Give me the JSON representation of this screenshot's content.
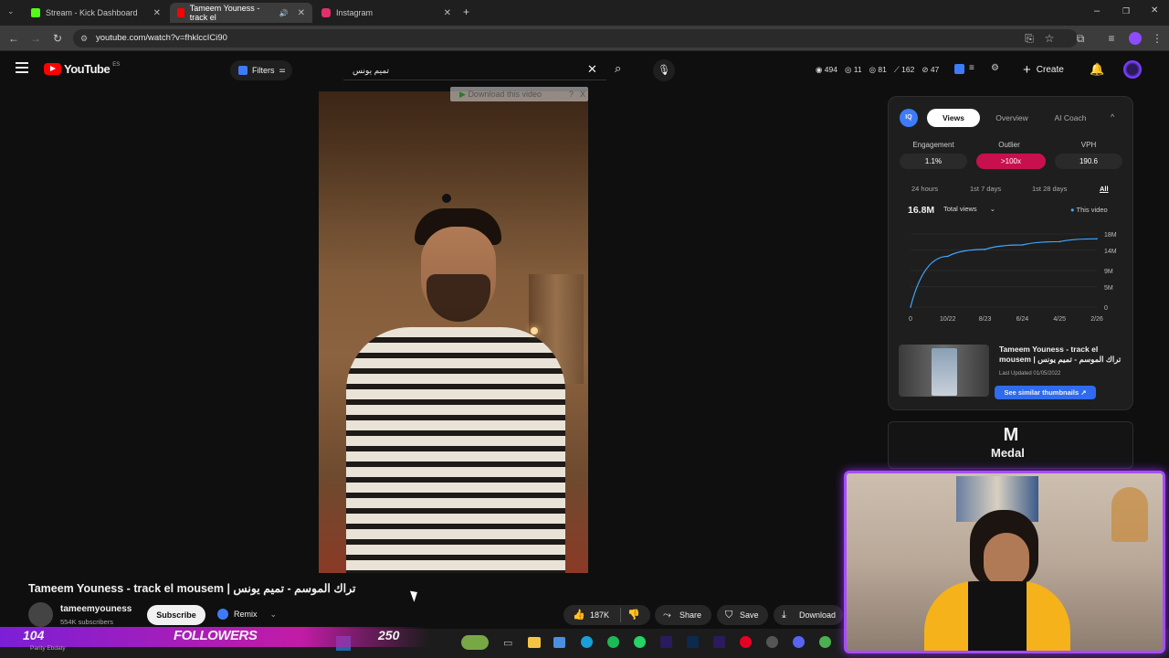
{
  "browser": {
    "tabs": [
      {
        "label": "Stream - Kick Dashboard",
        "color": "#53fc18"
      },
      {
        "label": "Tameem Youness - track el",
        "color": "#ff0000"
      },
      {
        "label": "Instagram",
        "color": "#e1306c"
      }
    ],
    "url": "youtube.com/watch?v=fhklccICi90"
  },
  "youtube": {
    "logo_text": "YouTube",
    "logo_sup": "ES",
    "filters_label": "Filters",
    "search_value": "تميم يونس",
    "stats": {
      "views": "494",
      "a": "11",
      "b": "81",
      "c": "162",
      "d": "47"
    },
    "create_label": "Create"
  },
  "download_bar": {
    "label": "Download this video",
    "q": "?",
    "x": "X"
  },
  "panel": {
    "tabs": [
      "Views",
      "Overview",
      "AI Coach"
    ],
    "metrics": [
      {
        "label": "Engagement",
        "value": "1.1%"
      },
      {
        "label": "Outlier",
        "value": ">100x"
      },
      {
        "label": "VPH",
        "value": "190.6"
      }
    ],
    "ranges": [
      "24 hours",
      "1st 7 days",
      "1st 28 days",
      "All"
    ],
    "total": "16.8M",
    "total_select": "Total views",
    "legend": "This video",
    "y_ticks": [
      "18M",
      "14M",
      "9M",
      "5M",
      "0"
    ],
    "x_ticks": [
      "0",
      "10/22",
      "8/23",
      "6/24",
      "4/25",
      "2/26"
    ],
    "video_title": "Tameem Youness - track el mousem | تراك الموسم - تميم يونس",
    "updated": "Last Updated 01/05/2022",
    "similar_btn": "See similar thumbnails"
  },
  "chart_data": {
    "type": "line",
    "x": [
      "0",
      "10/22",
      "8/23",
      "6/24",
      "4/25",
      "2/26"
    ],
    "series": [
      {
        "name": "This video",
        "values": [
          0,
          12.5,
          14.2,
          15.3,
          16.1,
          16.8
        ]
      }
    ],
    "ylim": [
      0,
      18
    ],
    "yticks": [
      "0",
      "5M",
      "9M",
      "14M",
      "18M"
    ]
  },
  "medal": {
    "label": "Medal"
  },
  "video": {
    "title": "Tameem Youness - track el mousem | تراك الموسم - تميم يونس",
    "channel": "tameemyouness",
    "subscribers": "554K subscribers",
    "subscribe": "Subscribe",
    "remix": "Remix",
    "likes": "187K",
    "share": "Share",
    "save": "Save",
    "download": "Download"
  },
  "overlay": {
    "count": "104",
    "label": "FOLLOWERS",
    "goal": "250",
    "sub": "Parity Ebdaty"
  },
  "colors": {
    "accent": "#3ea6ff",
    "outlier": "#c8104f",
    "overlay": "#8a2be2"
  }
}
